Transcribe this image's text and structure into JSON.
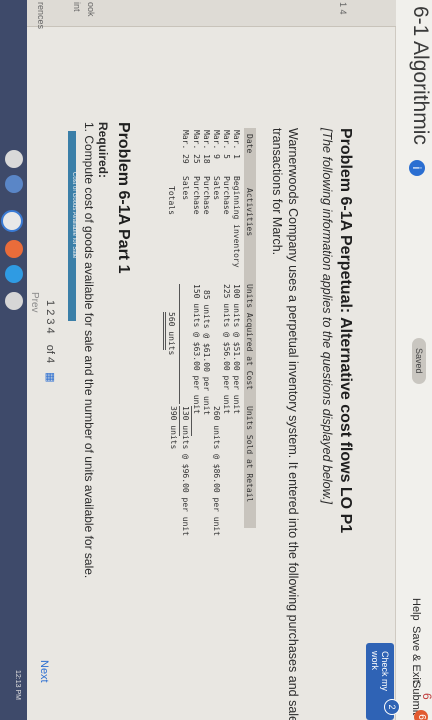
{
  "header": {
    "title": "6-1 Algorithmic",
    "info_glyph": "i",
    "saved": "Saved",
    "help": "Help",
    "save_exit": "Save & Exit",
    "submit": "Submit",
    "count": "6",
    "badge": "6"
  },
  "sidebar": {
    "items": [
      "1 4",
      "ook",
      "int",
      "rences"
    ]
  },
  "check_my_work": {
    "label": "Check my work",
    "badge": "2"
  },
  "problem": {
    "title": "Problem 6-1A Perpetual: Alternative cost flows LO P1",
    "note": "[The following information applies to the questions displayed below.]",
    "desc_line1": "Warnerwoods Company uses a perpetual inventory system. It entered into the following purchases and sales",
    "desc_line2": "transactions for March."
  },
  "table": {
    "headers": [
      "Date",
      "Activities",
      "Units Acquired at Cost",
      "Units Sold at Retail"
    ],
    "rows": [
      [
        "Mar. 1",
        "Beginning inventory",
        "100 units @ $51.00 per unit",
        ""
      ],
      [
        "Mar. 5",
        "Purchase",
        "225 units @ $56.00 per unit",
        ""
      ],
      [
        "Mar. 9",
        "Sales",
        "",
        "260 units @ $86.00 per unit"
      ],
      [
        "Mar. 18",
        "Purchase",
        "85 units @ $61.00 per unit",
        ""
      ],
      [
        "Mar. 25",
        "Purchase",
        "150 units @ $63.00 per unit",
        ""
      ],
      [
        "Mar. 29",
        "Sales",
        "",
        "130 units @ $96.00 per unit"
      ],
      [
        "",
        "Totals",
        "560 units",
        "390 units"
      ]
    ]
  },
  "part": {
    "title": "Problem 6-1A Part 1",
    "required_label": "Required:",
    "required_1": "1. Compute cost of goods available for sale and the number of units available for sale.",
    "tab_label": "Cost of Goods Available for Sale"
  },
  "pager": {
    "prev": "Prev",
    "current": "1",
    "pages": "2 3 4",
    "of_label": "of 4",
    "next": "Next"
  },
  "taskbar": {
    "time": "12:13 PM"
  },
  "colors": {
    "accent": "#2f63b5",
    "tab": "#3b7fa8"
  }
}
